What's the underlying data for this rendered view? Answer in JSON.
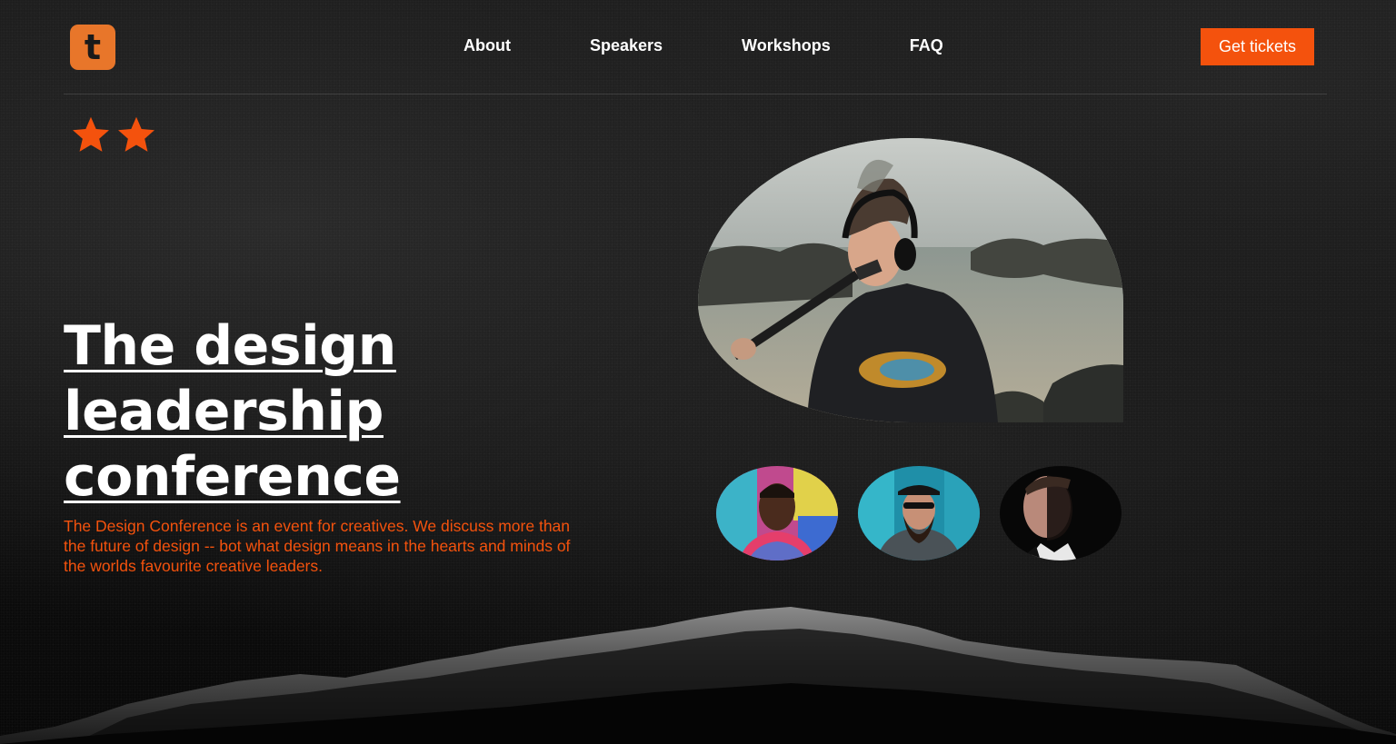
{
  "brand": {
    "logo_letter": "t",
    "accent": "#f4520d",
    "logo_bg": "#e8762a"
  },
  "nav": {
    "items": [
      {
        "label": "About"
      },
      {
        "label": "Speakers"
      },
      {
        "label": "Workshops"
      },
      {
        "label": "FAQ"
      }
    ]
  },
  "header": {
    "cta_label": "Get tickets"
  },
  "rating": {
    "stars": 2,
    "icon": "star-icon"
  },
  "hero": {
    "title": "The design leadership conference",
    "subtitle": "The Design Conference is an event for creatives. We discuss more than the future of design -- bot what design means in the hearts and minds of the worlds favourite creative leaders."
  },
  "speakers": {
    "featured": "featured-speaker-photo",
    "avatars": [
      "speaker-avatar-1",
      "speaker-avatar-2",
      "speaker-avatar-3"
    ]
  }
}
